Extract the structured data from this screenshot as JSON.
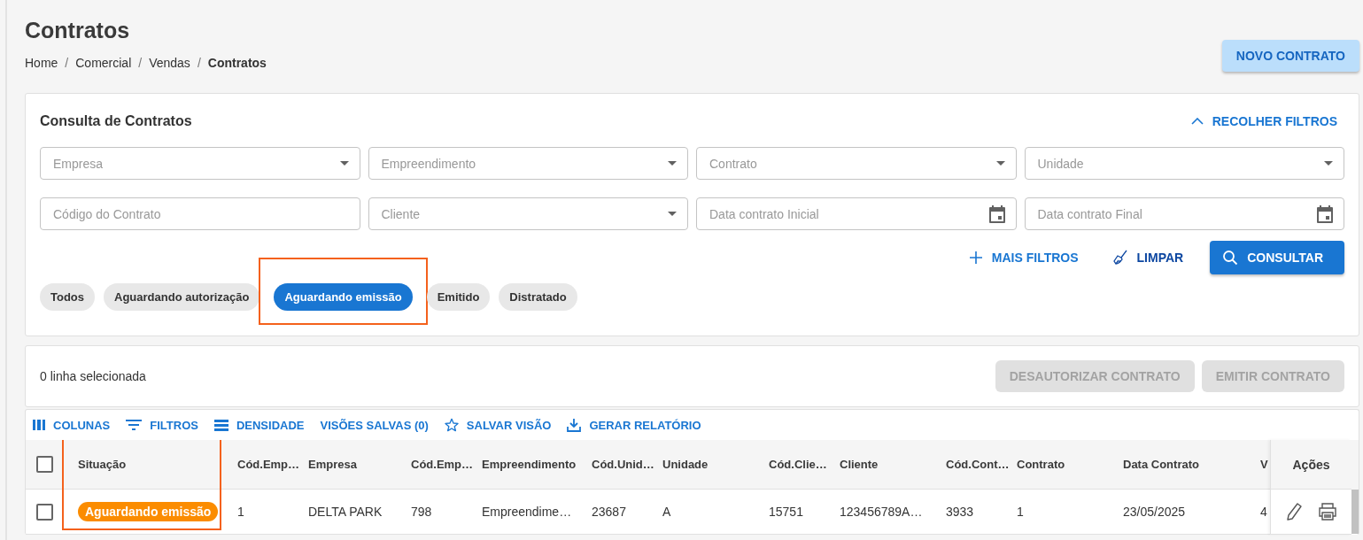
{
  "page": {
    "title": "Contratos",
    "separator": "/",
    "breadcrumb": [
      {
        "label": "Home",
        "current": false
      },
      {
        "label": "Comercial",
        "current": false
      },
      {
        "label": "Vendas",
        "current": false
      },
      {
        "label": "Contratos",
        "current": true
      }
    ],
    "new_button": "NOVO CONTRATO"
  },
  "filters": {
    "title": "Consulta de Contratos",
    "collapse": "RECOLHER FILTROS",
    "fields": [
      {
        "kind": "select",
        "placeholder": "Empresa"
      },
      {
        "kind": "select",
        "placeholder": "Empreendimento"
      },
      {
        "kind": "select",
        "placeholder": "Contrato"
      },
      {
        "kind": "select",
        "placeholder": "Unidade"
      },
      {
        "kind": "text",
        "placeholder": "Código do Contrato"
      },
      {
        "kind": "select",
        "placeholder": "Cliente"
      },
      {
        "kind": "date",
        "placeholder": "Data contrato Inicial"
      },
      {
        "kind": "date",
        "placeholder": "Data contrato Final"
      }
    ],
    "more": "MAIS FILTROS",
    "clear": "LIMPAR",
    "search": "CONSULTAR",
    "chips": [
      {
        "label": "Todos",
        "selected": false,
        "highlighted": false
      },
      {
        "label": "Aguardando autorização",
        "selected": false,
        "highlighted": false
      },
      {
        "label": "Aguardando emissão",
        "selected": true,
        "highlighted": true
      },
      {
        "label": "Emitido",
        "selected": false,
        "highlighted": false
      },
      {
        "label": "Distratado",
        "selected": false,
        "highlighted": false
      }
    ]
  },
  "selection": {
    "count": "0 linha selecionada",
    "buttons": [
      {
        "label": "DESAUTORIZAR CONTRATO",
        "disabled": true
      },
      {
        "label": "EMITIR CONTRATO",
        "disabled": true
      }
    ]
  },
  "toolbar": [
    {
      "kind": "columns",
      "label": "COLUNAS"
    },
    {
      "kind": "filter",
      "label": "FILTROS"
    },
    {
      "kind": "density",
      "label": "DENSIDADE"
    },
    {
      "kind": "plain",
      "label": "VISÕES SALVAS (0)"
    },
    {
      "kind": "star",
      "label": "SALVAR VISÃO"
    },
    {
      "kind": "download",
      "label": "GERAR RELATÓRIO"
    }
  ],
  "table": {
    "header_checked": false,
    "actions_label": "Ações",
    "columns": [
      {
        "label": "Situação",
        "highlighted": true
      },
      {
        "label": "Cód.Emp…",
        "highlighted": false
      },
      {
        "label": "Empresa",
        "highlighted": false
      },
      {
        "label": "Cód.Emp…",
        "highlighted": false
      },
      {
        "label": "Empreendimento",
        "highlighted": false
      },
      {
        "label": "Cód.Unid…",
        "highlighted": false
      },
      {
        "label": "Unidade",
        "highlighted": false
      },
      {
        "label": "Cód.Clie…",
        "highlighted": false
      },
      {
        "label": "Cliente",
        "highlighted": false
      },
      {
        "label": "Cód.Cont…",
        "highlighted": false
      },
      {
        "label": "Contrato",
        "highlighted": false
      },
      {
        "label": "Data Contrato",
        "highlighted": false
      },
      {
        "label": "V",
        "highlighted": false
      }
    ],
    "rows": [
      {
        "checked": false,
        "color": "#fb8c00",
        "cells": [
          "Aguardando emissão",
          "1",
          "DELTA PARK",
          "798",
          "Empreendime…",
          "23687",
          "A",
          "15751",
          "123456789A…",
          "3933",
          "1",
          "23/05/2025",
          "4"
        ]
      }
    ]
  }
}
